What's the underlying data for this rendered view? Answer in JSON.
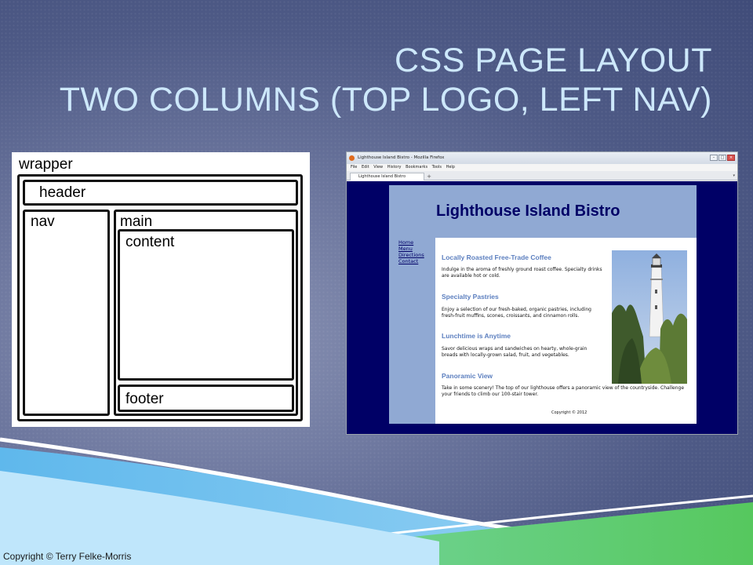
{
  "slide": {
    "title_line1": "CSS PAGE LAYOUT",
    "title_line2": "TWO COLUMNS (TOP LOGO, LEFT NAV)",
    "copyright": "Copyright © Terry Felke-Morris"
  },
  "diagram": {
    "wrapper": "wrapper",
    "header": "header",
    "nav": "nav",
    "main": "main",
    "content": "content",
    "footer": "footer"
  },
  "browser": {
    "window_title": "Lighthouse Island Bistro - Mozilla Firefox",
    "menu": [
      "File",
      "Edit",
      "View",
      "History",
      "Bookmarks",
      "Tools",
      "Help"
    ],
    "tab_title": "Lighthouse Island Bistro",
    "tab_new": "+"
  },
  "site": {
    "logo": "Lighthouse Island Bistro",
    "nav": [
      "Home",
      "Menu",
      "Directions",
      "Contact"
    ],
    "sections": [
      {
        "heading": "Locally Roasted Free-Trade Coffee",
        "text": "Indulge in the aroma of freshly ground roast coffee. Specialty drinks are available hot or cold."
      },
      {
        "heading": "Specialty Pastries",
        "text": "Enjoy a selection of our fresh-baked, organic pastries, including fresh-fruit muffins, scones, croissants, and cinnamon rolls."
      },
      {
        "heading": "Lunchtime is Anytime",
        "text": "Savor delicious wraps and sandwiches on hearty, whole-grain breads with locally-grown salad, fruit, and vegetables."
      },
      {
        "heading": "Panoramic View",
        "text": "Take in some scenery! The top of our lighthouse offers a panoramic view of the countryside. Challenge your friends to climb our 100-stair tower."
      }
    ],
    "copyright": "Copyright © 2012"
  },
  "colors": {
    "title": "#cde8fb",
    "site_blue": "#90a9d3",
    "site_navy": "#000066",
    "heading_blue": "#5c7fbf"
  },
  "icons": [
    "firefox-icon",
    "minimize-icon",
    "maximize-icon",
    "close-icon",
    "lighthouse-photo"
  ]
}
